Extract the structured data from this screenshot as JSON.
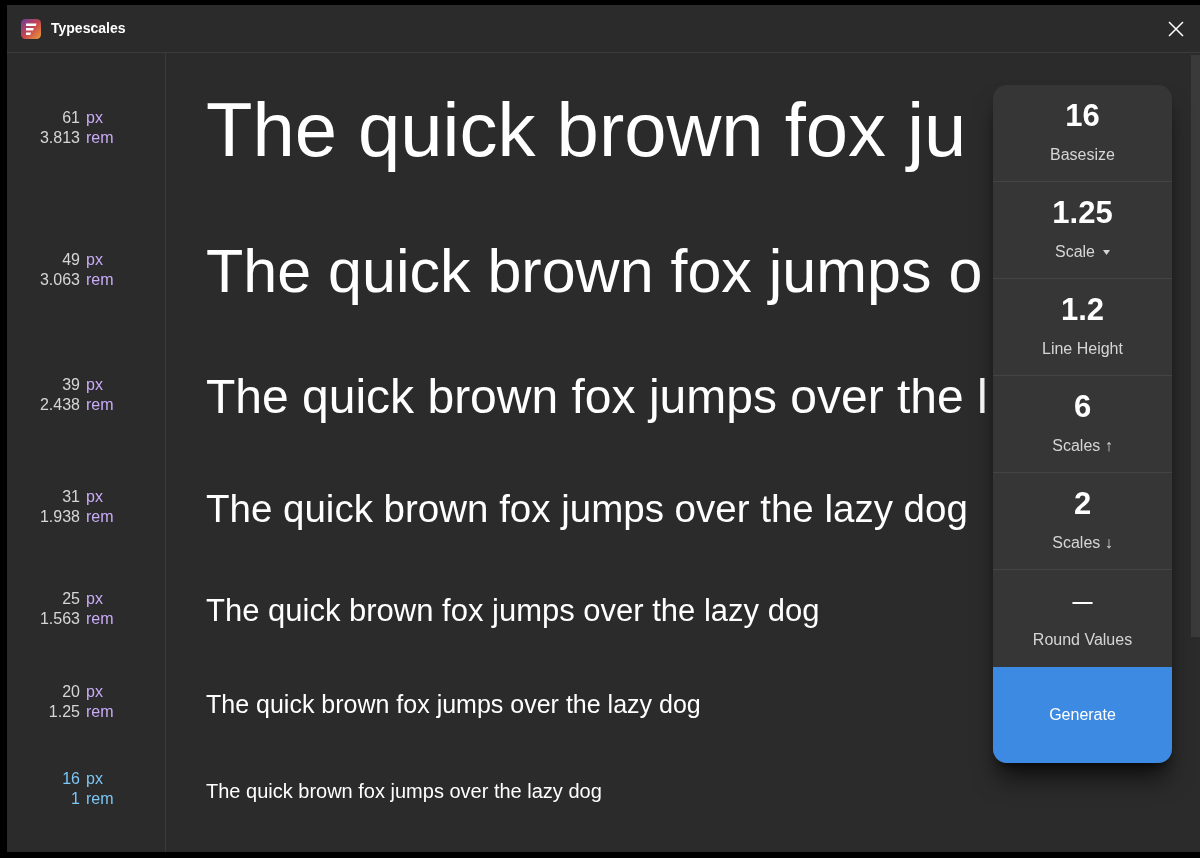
{
  "window": {
    "title": "Typescales"
  },
  "type_scale": [
    {
      "px": "61",
      "px_unit": "px",
      "rem": "3.813",
      "rem_unit": "rem",
      "sample": "The quick brown fox ju",
      "base": false
    },
    {
      "px": "49",
      "px_unit": "px",
      "rem": "3.063",
      "rem_unit": "rem",
      "sample": "The quick brown fox jumps o",
      "base": false
    },
    {
      "px": "39",
      "px_unit": "px",
      "rem": "2.438",
      "rem_unit": "rem",
      "sample": "The quick brown fox jumps over the l",
      "base": false
    },
    {
      "px": "31",
      "px_unit": "px",
      "rem": "1.938",
      "rem_unit": "rem",
      "sample": "The quick brown fox jumps over the lazy dog",
      "base": false
    },
    {
      "px": "25",
      "px_unit": "px",
      "rem": "1.563",
      "rem_unit": "rem",
      "sample": "The quick brown fox jumps over the lazy dog",
      "base": false
    },
    {
      "px": "20",
      "px_unit": "px",
      "rem": "1.25",
      "rem_unit": "rem",
      "sample": "The quick brown fox jumps over the lazy dog",
      "base": false
    },
    {
      "px": "16",
      "px_unit": "px",
      "rem": "1",
      "rem_unit": "rem",
      "sample": "The quick brown fox jumps over the lazy dog",
      "base": true
    }
  ],
  "settings_panel": {
    "settings": [
      {
        "kind": "number",
        "value": "16",
        "label": "Basesize"
      },
      {
        "kind": "dropdown",
        "value": "1.25",
        "label": "Scale"
      },
      {
        "kind": "number",
        "value": "1.2",
        "label": "Line Height"
      },
      {
        "kind": "number",
        "value": "6",
        "label": "Scales ↑"
      },
      {
        "kind": "number",
        "value": "2",
        "label": "Scales ↓"
      },
      {
        "kind": "symbol",
        "value": "—",
        "label": "Round Values"
      }
    ],
    "generate_button": "Generate"
  }
}
